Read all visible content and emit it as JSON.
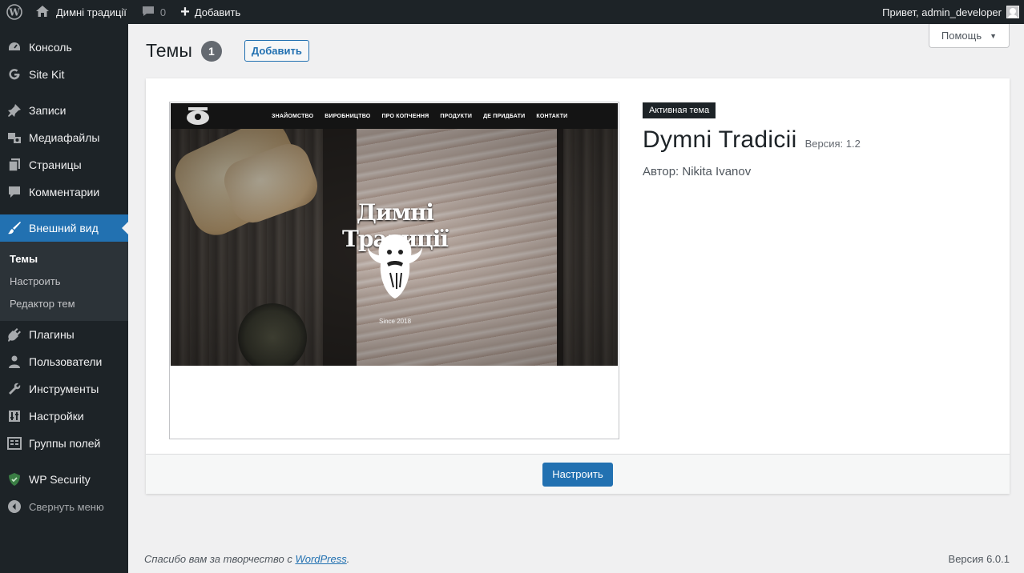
{
  "adminbar": {
    "site_name": "Димні традиції",
    "comments_count": "0",
    "new_label": "Добавить",
    "greeting": "Привет, admin_developer"
  },
  "sidebar": {
    "items": [
      {
        "label": "Консоль",
        "icon": "dashboard-icon"
      },
      {
        "label": "Site Kit",
        "icon": "google-g-icon"
      },
      {
        "label": "Записи",
        "icon": "pushpin-icon"
      },
      {
        "label": "Медиафайлы",
        "icon": "media-icon"
      },
      {
        "label": "Страницы",
        "icon": "pages-icon"
      },
      {
        "label": "Комментарии",
        "icon": "comment-icon"
      },
      {
        "label": "Внешний вид",
        "icon": "paintbrush-icon"
      },
      {
        "label": "Плагины",
        "icon": "plugin-icon"
      },
      {
        "label": "Пользователи",
        "icon": "users-icon"
      },
      {
        "label": "Инструменты",
        "icon": "wrench-icon"
      },
      {
        "label": "Настройки",
        "icon": "settings-sliders-icon"
      },
      {
        "label": "Группы полей",
        "icon": "fields-grid-icon"
      },
      {
        "label": "WP Security",
        "icon": "shield-icon"
      }
    ],
    "submenu": [
      "Темы",
      "Настроить",
      "Редактор тем"
    ],
    "collapse_label": "Свернуть меню"
  },
  "help": {
    "label": "Помощь"
  },
  "page": {
    "title": "Темы",
    "count": "1",
    "add_label": "Добавить"
  },
  "theme": {
    "active_label": "Активная тема",
    "name": "Dymni Tradicii",
    "version": "Версия: 1.2",
    "author": "Автор: Nikita Ivanov",
    "customize_label": "Настроить",
    "screenshot": {
      "nav_links": [
        "ЗНАЙОМСТВО",
        "ВИРОБНИЦТВО",
        "ПРО КОПЧЕННЯ",
        "ПРОДУКТИ",
        "ДЕ ПРИДБАТИ",
        "КОНТАКТИ"
      ],
      "brand": "Димні Традиції",
      "since": "Since 2018"
    }
  },
  "footer": {
    "thanks_prefix": "Спасибо вам за творчество с ",
    "wordpress_link": "WordPress",
    "thanks_suffix": ".",
    "version": "Версия 6.0.1"
  },
  "colors": {
    "accent": "#2271b1",
    "sidebar_bg": "#1d2327",
    "submenu_bg": "#2c3338",
    "page_bg": "#f0f0f1"
  }
}
